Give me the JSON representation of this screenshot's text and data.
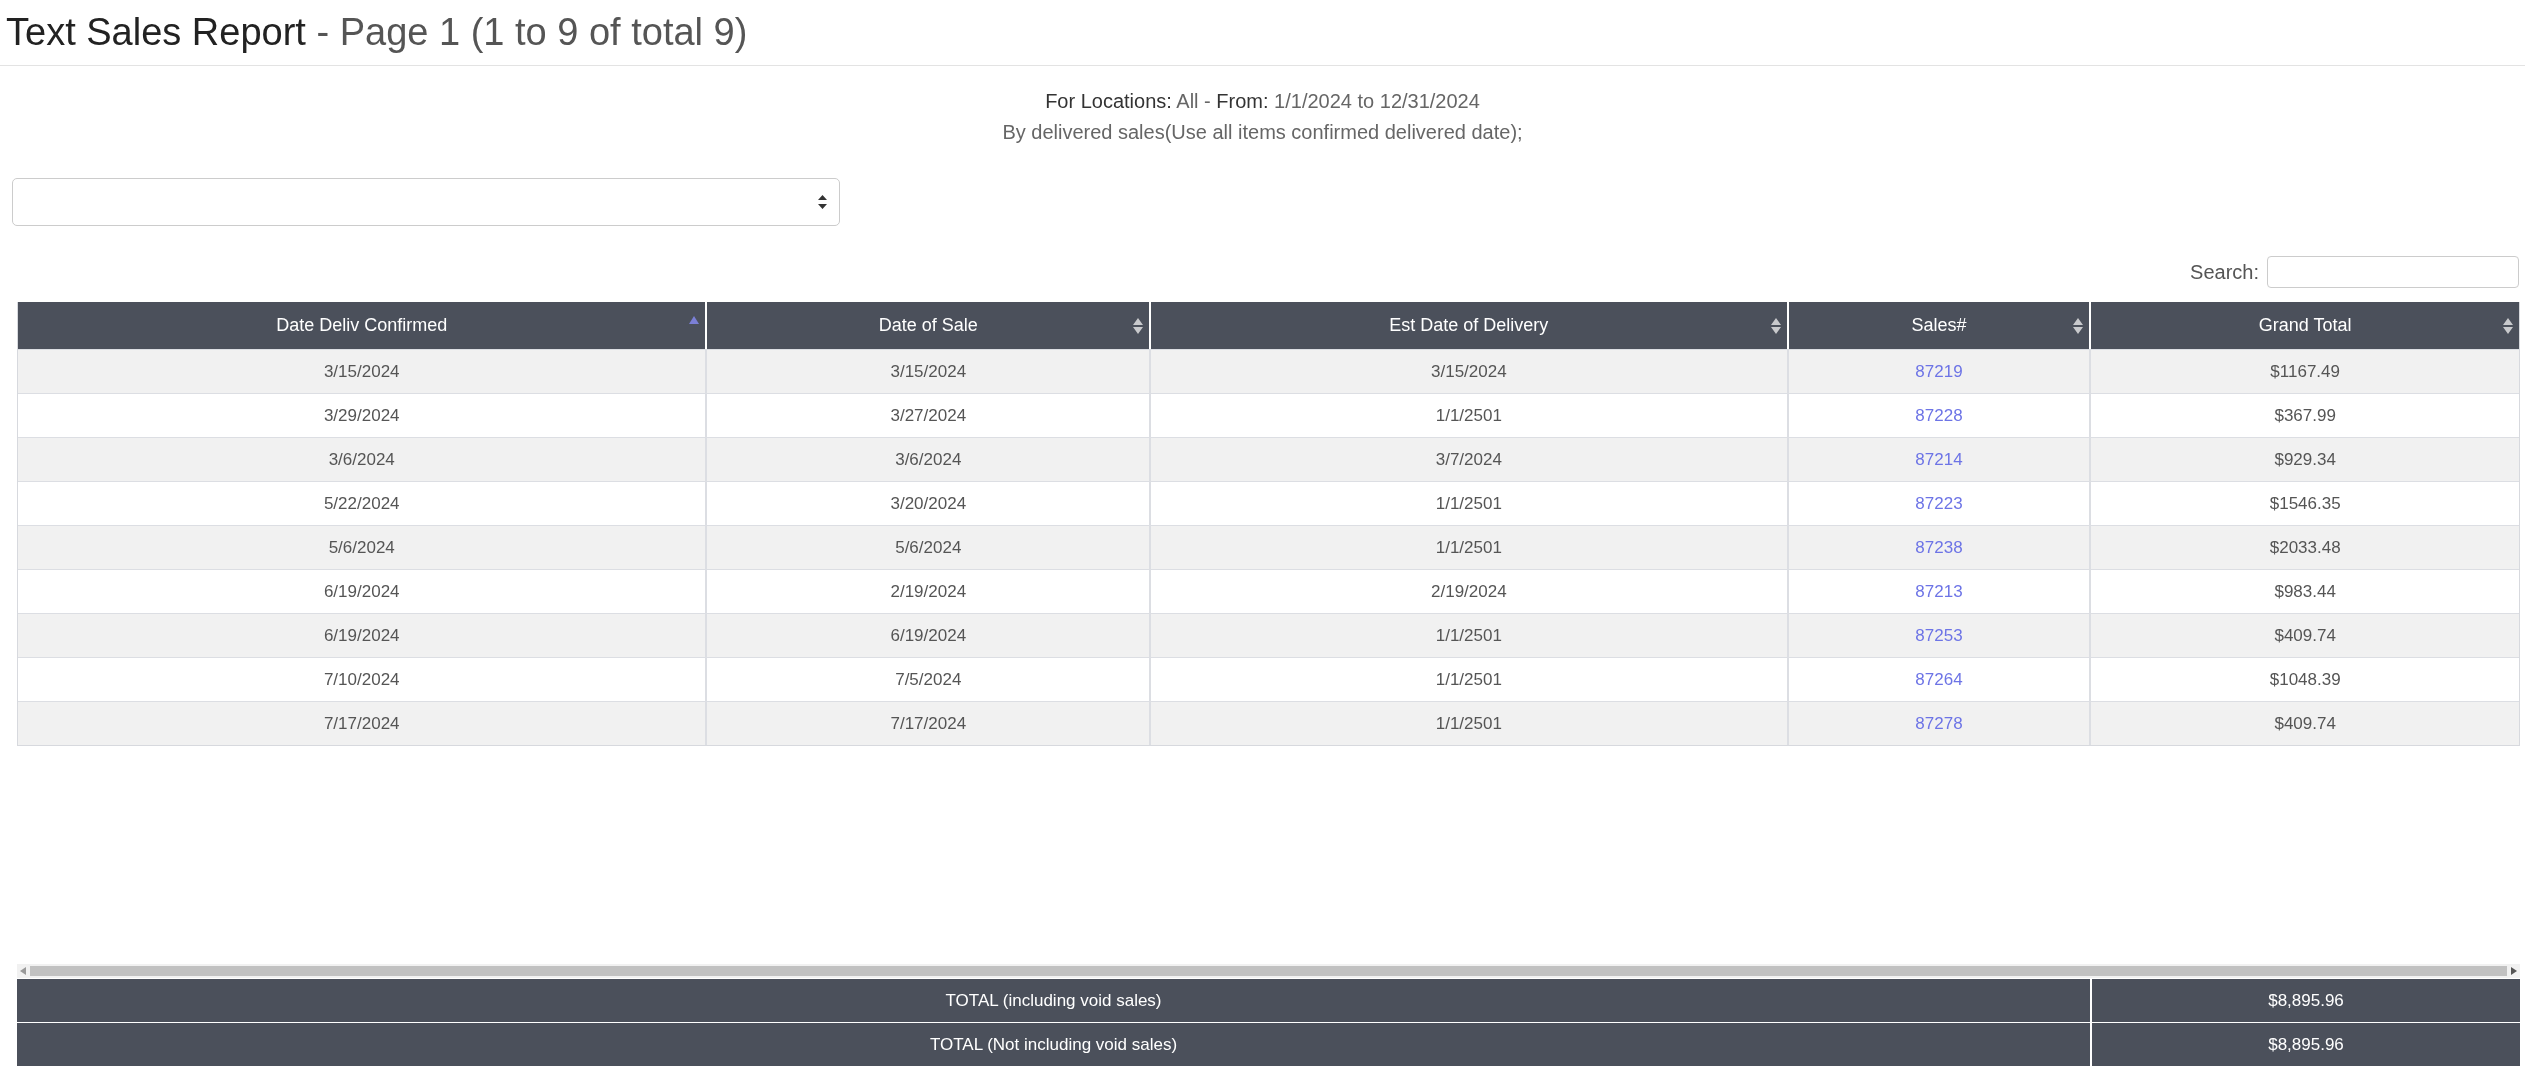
{
  "title": {
    "main": "Text Sales Report",
    "page": "- Page 1 (1 to 9 of total 9)"
  },
  "criteria": {
    "locations_label": "For Locations:",
    "locations": "All - ",
    "from_label": "From:",
    "from": "1/1/2024",
    "to_label": "to",
    "to": "12/31/2024",
    "mode": "By delivered sales(Use all items confirmed delivered date);"
  },
  "search": {
    "label": "Search:"
  },
  "table": {
    "columns": [
      {
        "label": "Date Deliv Confirmed",
        "sorted": true
      },
      {
        "label": "Date of Sale",
        "sorted": false
      },
      {
        "label": "Est Date of Delivery",
        "sorted": false
      },
      {
        "label": "Sales#",
        "sorted": false
      },
      {
        "label": "Grand Total",
        "sorted": false
      }
    ],
    "rows": [
      [
        "3/15/2024",
        "3/15/2024",
        "3/15/2024",
        "87219",
        "$1167.49"
      ],
      [
        "3/29/2024",
        "3/27/2024",
        "1/1/2501",
        "87228",
        "$367.99"
      ],
      [
        "3/6/2024",
        "3/6/2024",
        "3/7/2024",
        "87214",
        "$929.34"
      ],
      [
        "5/22/2024",
        "3/20/2024",
        "1/1/2501",
        "87223",
        "$1546.35"
      ],
      [
        "5/6/2024",
        "5/6/2024",
        "1/1/2501",
        "87238",
        "$2033.48"
      ],
      [
        "6/19/2024",
        "2/19/2024",
        "2/19/2024",
        "87213",
        "$983.44"
      ],
      [
        "6/19/2024",
        "6/19/2024",
        "1/1/2501",
        "87253",
        "$409.74"
      ],
      [
        "7/10/2024",
        "7/5/2024",
        "1/1/2501",
        "87264",
        "$1048.39"
      ],
      [
        "7/17/2024",
        "7/17/2024",
        "1/1/2501",
        "87278",
        "$409.74"
      ]
    ]
  },
  "totals": [
    {
      "label": "TOTAL (including void sales)",
      "value": "$8,895.96"
    },
    {
      "label": "TOTAL (Not including void sales)",
      "value": "$8,895.96"
    }
  ]
}
